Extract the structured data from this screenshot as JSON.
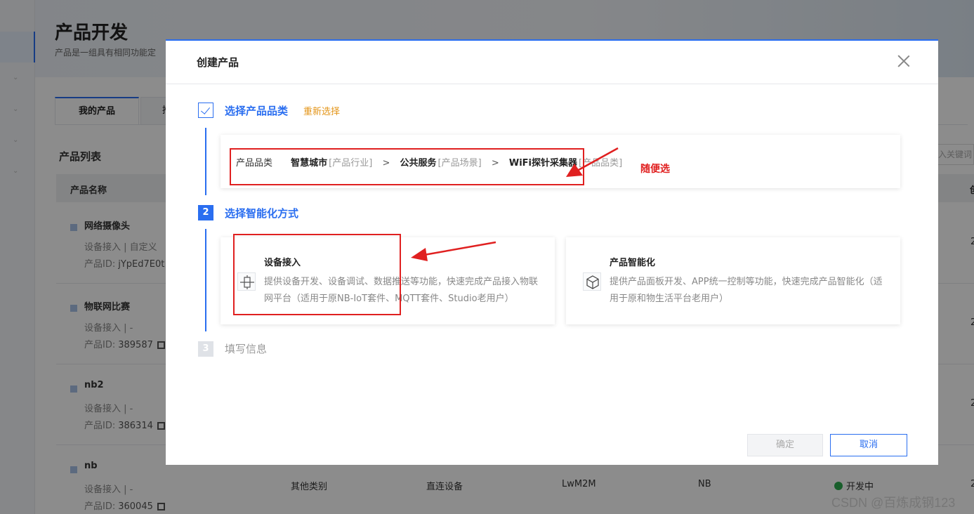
{
  "background": {
    "page_title": "产品开发",
    "page_desc": "产品是一组具有相同功能定",
    "tabs": [
      "我的产品",
      "推"
    ],
    "list_title": "产品列表",
    "search_placeholder": "入关键词",
    "col_name": "产品名称",
    "col_last": "创",
    "rows": [
      {
        "name": "网络摄像头",
        "line2": "设备接入  |  自定义",
        "id_label": "产品ID:",
        "id": "jYpEd7E0t",
        "right": "2"
      },
      {
        "name": "物联网比赛",
        "line2": "设备接入  |  -",
        "id_label": "产品ID:",
        "id": "389587",
        "right": "2"
      },
      {
        "name": "nb2",
        "line2": "设备接入  |  -",
        "id_label": "产品ID:",
        "id": "386314",
        "right": "2"
      },
      {
        "name": "nb",
        "line2": "设备接入  |  -",
        "id_label": "产品ID:",
        "id": "360045",
        "category": "其他类别",
        "node": "直连设备",
        "protocol": "LwM2M",
        "network": "NB",
        "status": "开发中",
        "right": "2"
      }
    ]
  },
  "modal": {
    "title": "创建产品",
    "step1": {
      "num": "1",
      "label": "选择产品品类",
      "reselect": "重新选择"
    },
    "category": {
      "key": "产品品类",
      "industry": "智慧城市",
      "industry_tag": "[产品行业]",
      "scene": "公共服务",
      "scene_tag": "[产品场景]",
      "type": "WiFi探针采集器",
      "type_tag": "[产品品类]",
      "sep": ">"
    },
    "step2": {
      "num": "2",
      "label": "选择智能化方式"
    },
    "options": [
      {
        "title": "设备接入",
        "desc": "提供设备开发、设备调试、数据推送等功能，快速完成产品接入物联网平台（适用于原NB-IoT套件、MQTT套件、Studio老用户）",
        "icon": "device-access-icon"
      },
      {
        "title": "产品智能化",
        "desc": "提供产品面板开发、APP统一控制等功能，快速完成产品智能化（适用于原和物生活平台老用户）",
        "icon": "cube-icon"
      }
    ],
    "step3": {
      "num": "3",
      "label": "填写信息"
    },
    "ok": "确定",
    "cancel": "取消"
  },
  "annotation": {
    "note": "随便选",
    "color": "#e02020"
  },
  "watermark": "CSDN @百炼成钢123"
}
